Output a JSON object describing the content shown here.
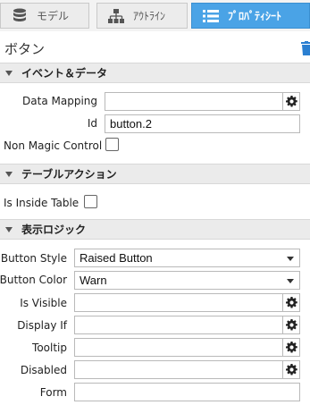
{
  "tabs": [
    {
      "label": "モデル",
      "icon": "database-icon"
    },
    {
      "label": "ｱｳﾄﾗｲﾝ",
      "icon": "hierarchy-icon"
    },
    {
      "label": "ﾌﾟﾛﾊﾟﾃｨｼｰﾄ",
      "icon": "list-icon",
      "active": true
    }
  ],
  "title": "ボタン",
  "sections": {
    "events": "イベント＆データ",
    "table": "テーブルアクション",
    "display": "表示ロジック"
  },
  "props": {
    "data_mapping": {
      "label": "Data Mapping",
      "value": ""
    },
    "id": {
      "label": "Id",
      "value": "button.2"
    },
    "non_magic": {
      "label": "Non Magic Control"
    },
    "inside_table": {
      "label": "Is Inside Table"
    },
    "button_style": {
      "label": "Button Style",
      "value": "Raised Button"
    },
    "button_color": {
      "label": "Button Color",
      "value": "Warn"
    },
    "is_visible": {
      "label": "Is Visible",
      "value": ""
    },
    "display_if": {
      "label": "Display If",
      "value": ""
    },
    "tooltip": {
      "label": "Tooltip",
      "value": ""
    },
    "disabled": {
      "label": "Disabled",
      "value": ""
    },
    "form": {
      "label": "Form",
      "value": ""
    }
  },
  "colors": {
    "active_tab": "#4aa3e6",
    "section_bg": "#ebebeb",
    "trash": "#2b7fd1"
  }
}
